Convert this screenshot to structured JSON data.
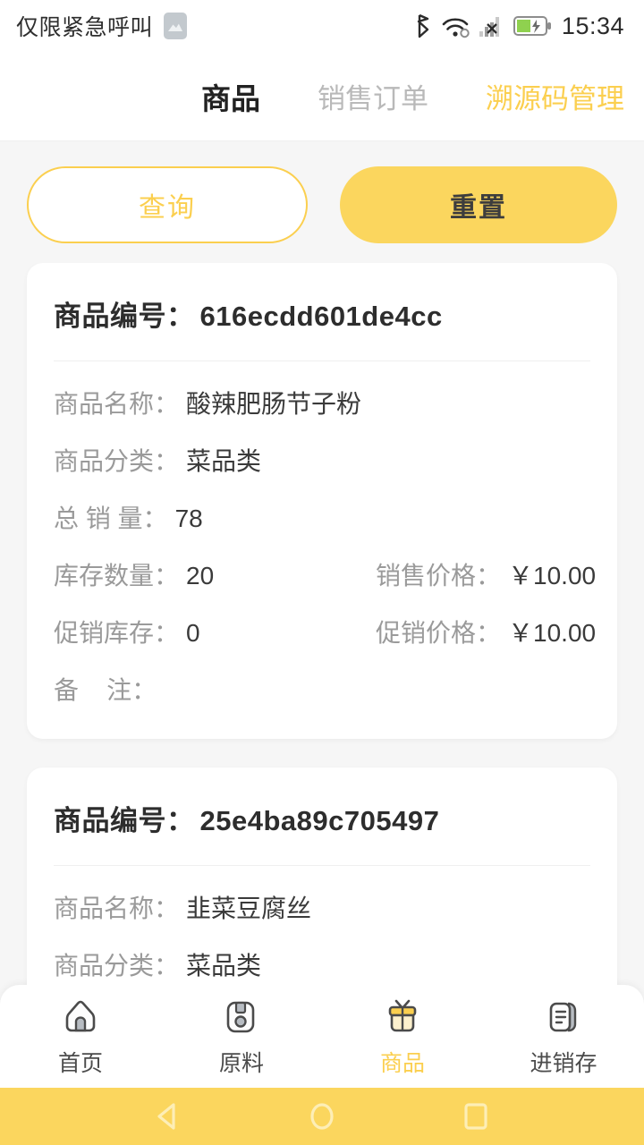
{
  "statusbar": {
    "carrier": "仅限紧急呼叫",
    "screenshot_icon": "image-icon",
    "bluetooth_icon": "bluetooth-icon",
    "wifi_icon": "wifi-icon",
    "signal_icon": "signal-no-service-icon",
    "battery_icon": "battery-charging-icon",
    "clock": "15:34"
  },
  "tabs": [
    {
      "label": "商品",
      "state": "active"
    },
    {
      "label": "销售订单",
      "state": "muted"
    },
    {
      "label": "溯源码管理",
      "state": "accent"
    }
  ],
  "actions": {
    "query_label": "查询",
    "reset_label": "重置"
  },
  "colors": {
    "accent": "#fbcf4f",
    "accent_solid": "#fbd65e",
    "page_background": "#f6f6f6",
    "card_background": "#ffffff",
    "label_text": "#9a9a9a",
    "value_text": "#3a3a3a",
    "title_text": "#2d2d2d",
    "muted_tab": "#b9b9b9"
  },
  "products": [
    {
      "id_label": "商品编号：",
      "id_value": "616ecdd601de4cc",
      "fields": [
        [
          {
            "label": "商品名称：",
            "value": "酸辣肥肠节子粉"
          }
        ],
        [
          {
            "label": "商品分类：",
            "value": "菜品类"
          }
        ],
        [
          {
            "label": "总 销 量：",
            "value": "78"
          }
        ],
        [
          {
            "label": "库存数量：",
            "value": "20"
          },
          {
            "label": "销售价格：",
            "value": "￥10.00"
          }
        ],
        [
          {
            "label": "促销库存：",
            "value": "0"
          },
          {
            "label": "促销价格：",
            "value": "￥10.00"
          }
        ],
        [
          {
            "label": "备    注：",
            "value": ""
          }
        ]
      ]
    },
    {
      "id_label": "商品编号：",
      "id_value": "25e4ba89c705497",
      "fields": [
        [
          {
            "label": "商品名称：",
            "value": "韭菜豆腐丝"
          }
        ],
        [
          {
            "label": "商品分类：",
            "value": "菜品类"
          }
        ]
      ]
    }
  ],
  "bottomnav": [
    {
      "label": "首页",
      "icon": "home-icon",
      "active": false
    },
    {
      "label": "原料",
      "icon": "material-icon",
      "active": false
    },
    {
      "label": "商品",
      "icon": "gift-icon",
      "active": true
    },
    {
      "label": "进销存",
      "icon": "document-icon",
      "active": false
    }
  ],
  "androidnav": {
    "back_icon": "back-triangle-icon",
    "home_icon": "home-circle-icon",
    "recents_icon": "recents-square-icon"
  }
}
